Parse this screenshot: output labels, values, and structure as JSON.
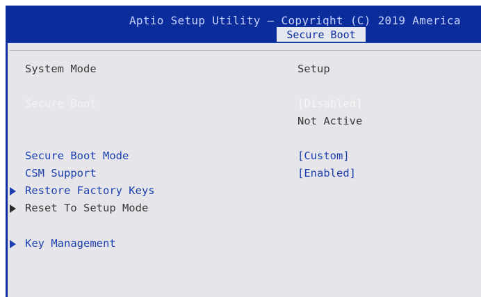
{
  "header": {
    "title": "Aptio Setup Utility – Copyright (C) 2019 America",
    "active_tab": "Secure Boot"
  },
  "settings": [
    {
      "label": "System Mode",
      "value": "Setup"
    },
    {
      "label": "Secure Boot",
      "value": "[Disabled]"
    },
    {
      "label": "",
      "value": "Not Active"
    },
    {
      "label": "Secure Boot Mode",
      "value": "[Custom]"
    },
    {
      "label": "CSM Support",
      "value": "[Enabled]"
    }
  ],
  "submenus": [
    {
      "label": "Restore Factory Keys"
    },
    {
      "label": "Reset To Setup Mode"
    },
    {
      "label": "Key Management"
    }
  ],
  "colors": {
    "header_background": "#0b2d9c",
    "panel_background": "#e6e6ea",
    "selectable_text": "#1c3fb0",
    "static_text": "#3a3a3a"
  },
  "icons": {
    "submenu_arrow": "triangle-right-icon"
  }
}
